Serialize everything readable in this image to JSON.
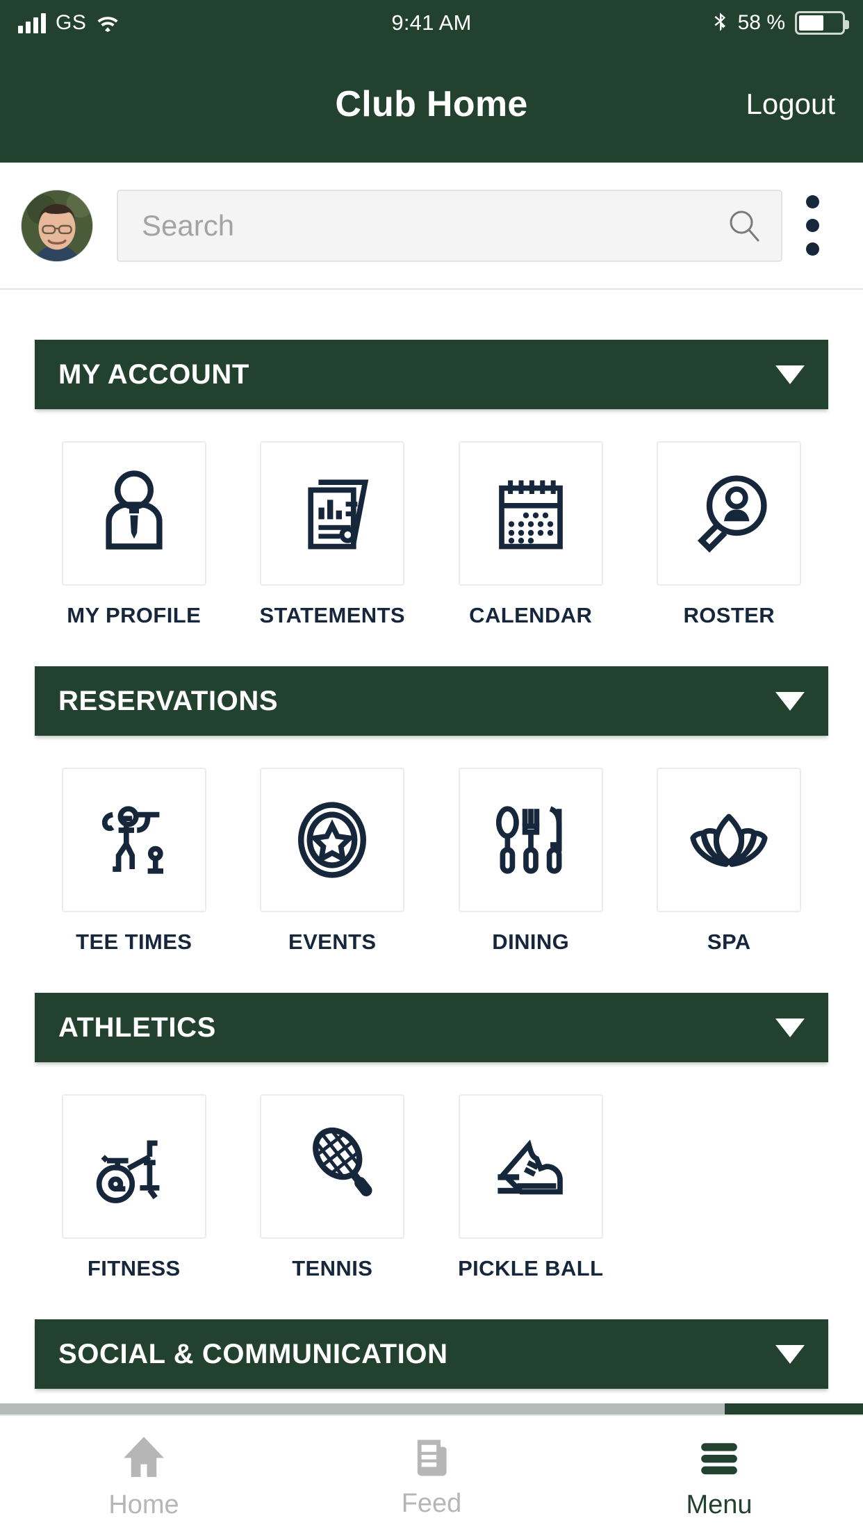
{
  "status_bar": {
    "carrier": "GS",
    "time": "9:41 AM",
    "battery_percent": "58 %",
    "signal_icon": "signal-bars-icon",
    "wifi_icon": "wifi-icon",
    "bluetooth_icon": "bluetooth-icon",
    "battery_icon": "battery-icon",
    "battery_fill_percent": 58
  },
  "header": {
    "title": "Club Home",
    "logout_label": "Logout",
    "background_color": "#22412f",
    "text_color": "#ffffff"
  },
  "search": {
    "placeholder": "Search",
    "value": "",
    "search_icon": "search-icon",
    "avatar_name": "user-avatar",
    "overflow_icon": "kebab-menu-icon"
  },
  "sections": [
    {
      "title": "MY ACCOUNT",
      "caret_icon": "chevron-down-icon",
      "expanded": true,
      "tiles": [
        {
          "label": "MY PROFILE",
          "icon": "person-tie-icon"
        },
        {
          "label": "STATEMENTS",
          "icon": "documents-chart-icon"
        },
        {
          "label": "CALENDAR",
          "icon": "calendar-icon"
        },
        {
          "label": "ROSTER",
          "icon": "magnifier-person-icon"
        }
      ]
    },
    {
      "title": "RESERVATIONS",
      "caret_icon": "chevron-down-icon",
      "expanded": true,
      "tiles": [
        {
          "label": "TEE TIMES",
          "icon": "golfer-icon"
        },
        {
          "label": "EVENTS",
          "icon": "star-badge-icon"
        },
        {
          "label": "DINING",
          "icon": "cutlery-icon"
        },
        {
          "label": "SPA",
          "icon": "lotus-icon"
        }
      ]
    },
    {
      "title": "ATHLETICS",
      "caret_icon": "chevron-down-icon",
      "expanded": true,
      "tiles": [
        {
          "label": "FITNESS",
          "icon": "exercise-bike-icon"
        },
        {
          "label": "TENNIS",
          "icon": "tennis-racket-icon"
        },
        {
          "label": "PICKLE BALL",
          "icon": "running-shoe-icon"
        }
      ]
    },
    {
      "title": "SOCIAL & COMMUNICATION",
      "caret_icon": "chevron-down-icon",
      "expanded": false,
      "tiles": []
    }
  ],
  "scroll_indicator": {
    "track_percent": 84,
    "track_color": "#b4bbb9",
    "thumb_color": "#22412f"
  },
  "tabbar": {
    "items": [
      {
        "label": "Home",
        "icon": "home-icon",
        "active": false
      },
      {
        "label": "Feed",
        "icon": "newspaper-icon",
        "active": false
      },
      {
        "label": "Menu",
        "icon": "hamburger-icon",
        "active": true
      }
    ],
    "inactive_color": "#b6b6b6",
    "active_color": "#22412f"
  },
  "theme": {
    "brand_green": "#22412f",
    "icon_navy": "#16263b",
    "card_border": "#ececec",
    "field_bg": "#f4f4f4"
  }
}
